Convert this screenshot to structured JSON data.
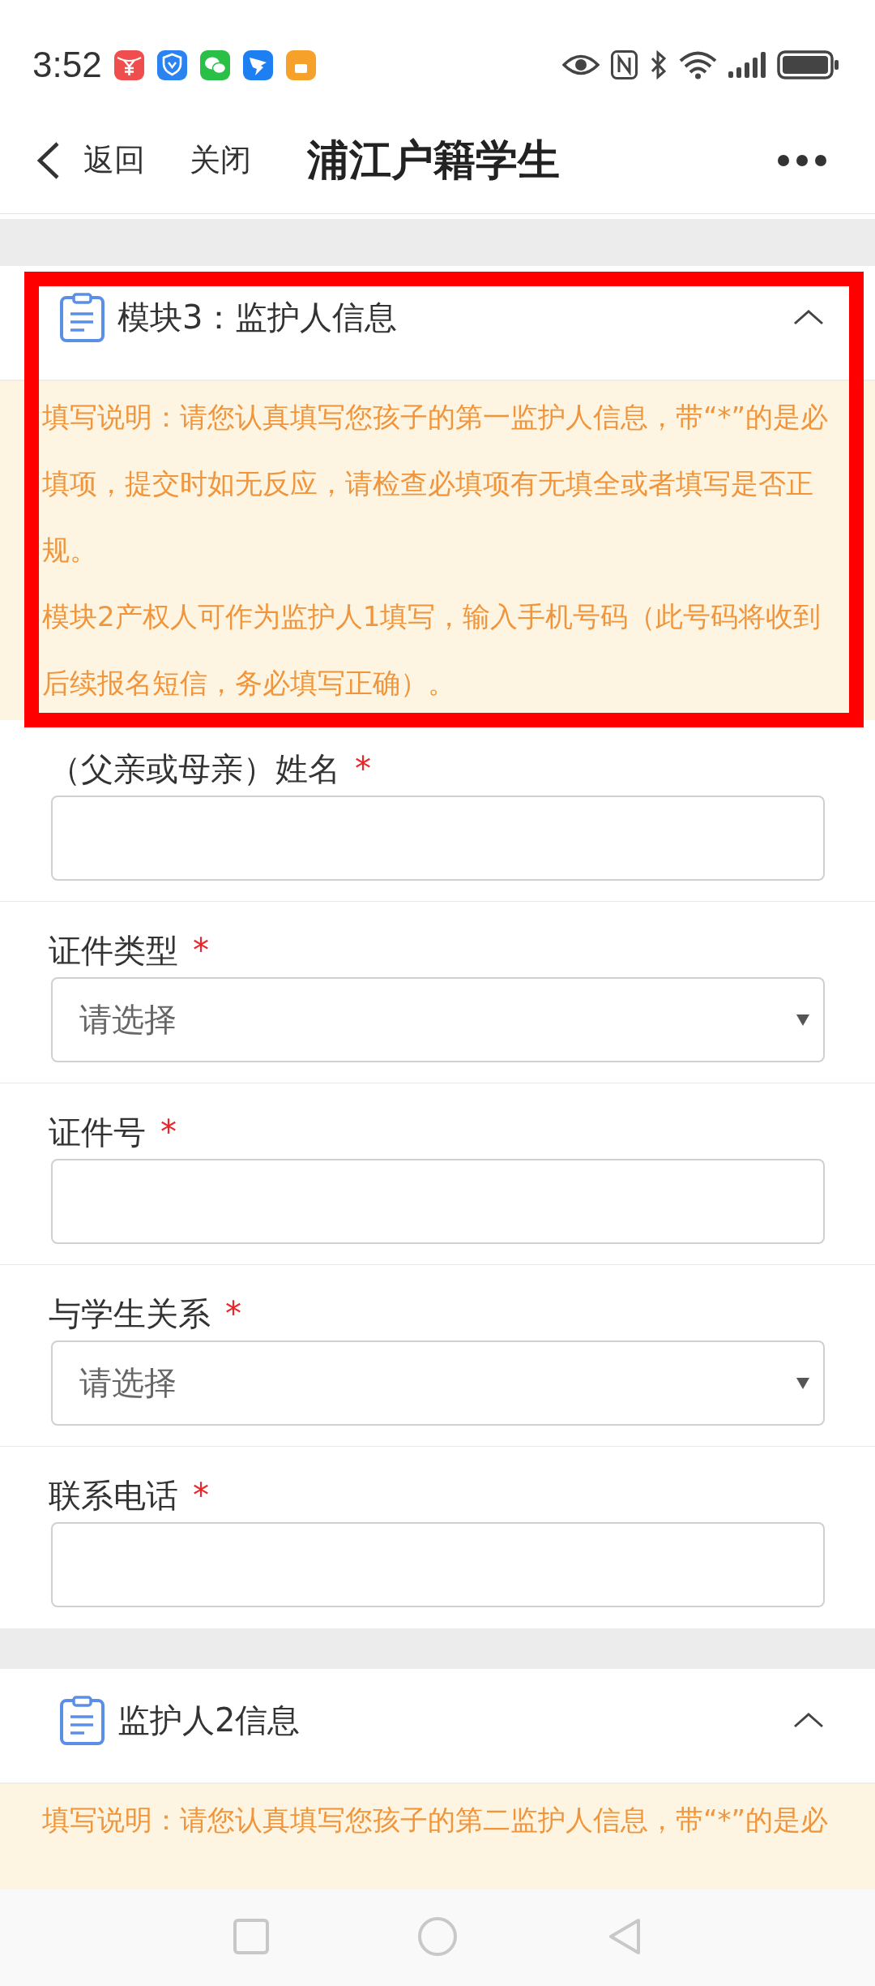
{
  "status_bar": {
    "time": "3:52"
  },
  "header": {
    "back_label": "返回",
    "close_label": "关闭",
    "title": "浦江户籍学生"
  },
  "sections": [
    {
      "title": "模块3：监护人信息",
      "expanded": true,
      "highlighted": true,
      "instructions": [
        "填写说明：请您认真填写您孩子的第一监护人信息，带“*”的是必填项，提交时如无反应，请检查必填项有无填全或者填写是否正规。",
        "模块2产权人可作为监护人1填写，输入手机号码（此号码将收到后续报名短信，务必填写正确）。"
      ],
      "fields": [
        {
          "kind": "text",
          "label": "（父亲或母亲）姓名",
          "mark": "*"
        },
        {
          "kind": "select",
          "label": "证件类型",
          "mark": "*",
          "placeholder": "请选择"
        },
        {
          "kind": "text",
          "label": "证件号",
          "mark": "*"
        },
        {
          "kind": "select",
          "label": "与学生关系",
          "mark": "*",
          "placeholder": "请选择"
        },
        {
          "kind": "text",
          "label": "联系电话",
          "mark": "*"
        }
      ]
    },
    {
      "title": "监护人2信息",
      "expanded": true,
      "highlighted": false,
      "instructions": [
        "填写说明：请您认真填写您孩子的第二监护人信息，带“*”的是必"
      ]
    }
  ]
}
